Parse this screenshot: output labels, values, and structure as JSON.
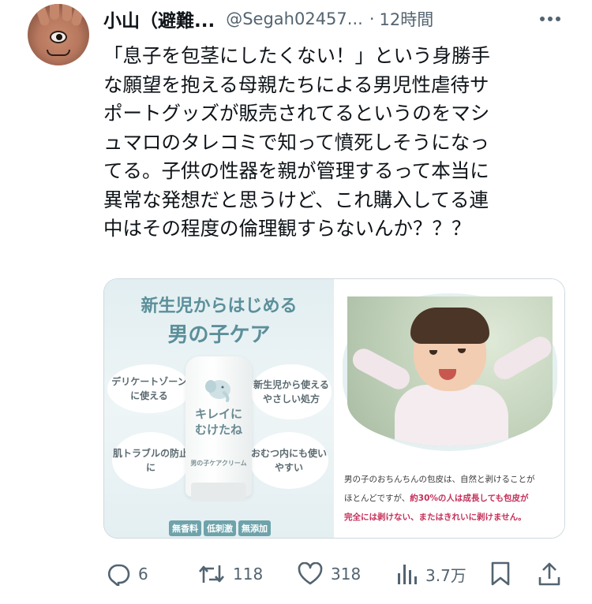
{
  "author": {
    "name": "小山（避難...",
    "handle": "@Segah02457...",
    "separator": "·",
    "time": "12時間"
  },
  "tweet": {
    "lines": [
      "「息子を包茎にしたくない！」という身勝手",
      "な願望を抱える母親たちによる男児性虐待サ",
      "ポートグッズが販売されてるというのをマシ",
      "ュマロのタレコミで知って憤死しそうになっ",
      "てる。子供の性器を親が管理するって本当に",
      "異常な発想だと思うけど、これ購入してる連",
      "中はその程度の倫理観すらないんか？？？"
    ]
  },
  "media": {
    "left": {
      "title_line1": "新生児からはじめる",
      "title_line2": "男の子ケア",
      "bubble_tl": "デリケートゾーンに使える",
      "bubble_tr": "新生児から使えるやさしい処方",
      "bubble_bl": "肌トラブルの防止に",
      "bubble_br": "おむつ内にも使いやすい",
      "product_name_1": "キレイに",
      "product_name_2": "むけたね",
      "product_sub": "男の子ケアクリーム",
      "tags": [
        "無香料",
        "低刺激",
        "無添加"
      ]
    },
    "right": {
      "desc_line1": "男の子のおちんちんの包皮は、自然と剥けることが",
      "desc_line2": "ほとんどですが、",
      "desc_em1": "約30%の人は成長しても包皮が",
      "desc_em2": "完全には剥けない、またはきれいに剥けません。"
    }
  },
  "actions": {
    "reply_count": "6",
    "retweet_count": "118",
    "like_count": "318",
    "view_count": "3.7万"
  },
  "icons": {
    "more": "more-icon",
    "reply": "reply-icon",
    "retweet": "retweet-icon",
    "like": "like-icon",
    "views": "views-icon",
    "bookmark": "bookmark-icon",
    "share": "share-icon"
  },
  "colors": {
    "text": "#0f1419",
    "secondary": "#536471",
    "ad_accent": "#5b8f9a",
    "emphasis": "#c5305a"
  }
}
